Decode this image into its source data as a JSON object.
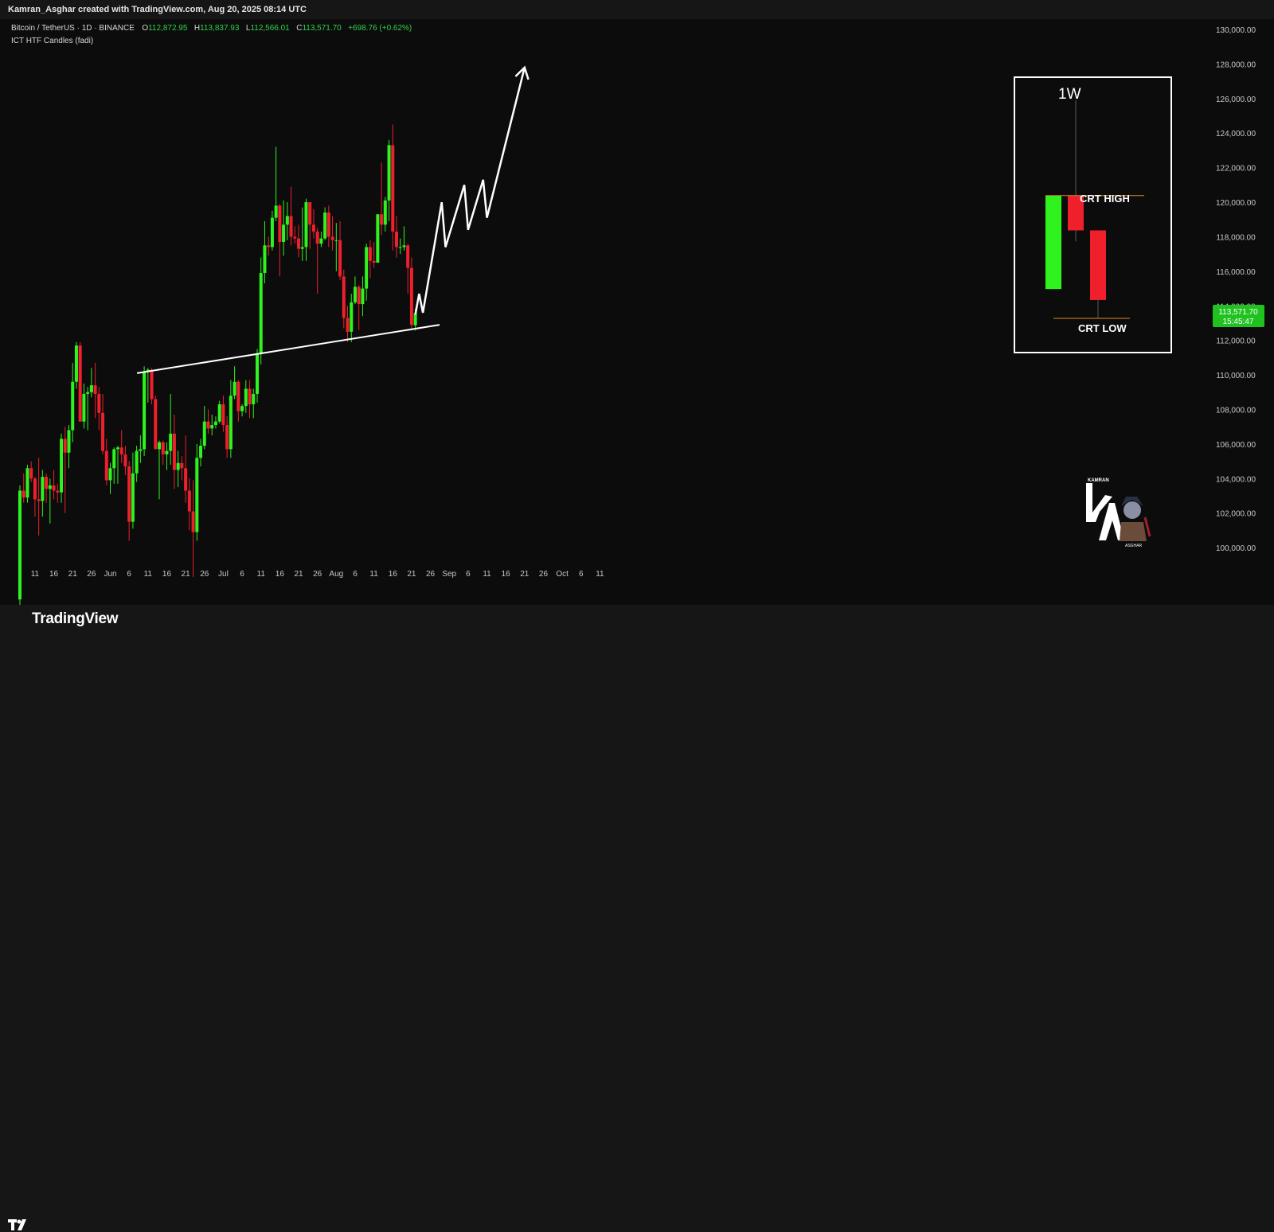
{
  "header": {
    "credit": "Kamran_Asghar created with TradingView.com, Aug 20, 2025 08:14 UTC"
  },
  "legend": {
    "symbol": "Bitcoin / TetherUS · 1D · BINANCE",
    "o_label": "O",
    "open": "112,872.95",
    "h_label": "H",
    "high": "113,837.93",
    "l_label": "L",
    "low": "112,566.01",
    "c_label": "C",
    "close": "113,571.70",
    "change": "+698.76 (+0.62%)",
    "indicator": "ICT HTF Candles (fadi)"
  },
  "price_tag": {
    "price": "113,571.70",
    "countdown": "15:45:47"
  },
  "inset": {
    "timeframe": "1W",
    "crt_high": "CRT HIGH",
    "crt_low": "CRT LOW"
  },
  "watermark": {
    "top": "KAMRAN",
    "bottom": "ASGHAR"
  },
  "footer": {
    "brand": "TradingView",
    "brand_mark": "TV"
  },
  "colors": {
    "up": "#2ff31f",
    "down": "#ef1f2c",
    "background": "#0c0c0c",
    "line": "#ffffff",
    "tag": "#1fc21f"
  },
  "chart_data": {
    "type": "candlestick",
    "symbol": "BTCUSDT",
    "interval": "1D",
    "x_axis_labels": [
      "11",
      "16",
      "21",
      "26",
      "Jun",
      "6",
      "11",
      "16",
      "21",
      "26",
      "Jul",
      "6",
      "11",
      "16",
      "21",
      "26",
      "Aug",
      "6",
      "11",
      "16",
      "21",
      "26",
      "Sep",
      "6",
      "11",
      "16",
      "21",
      "26",
      "Oct",
      "6",
      "11"
    ],
    "y_axis_labels": [
      "100,000.00",
      "102,000.00",
      "104,000.00",
      "106,000.00",
      "108,000.00",
      "110,000.00",
      "112,000.00",
      "114,000.00",
      "116,000.00",
      "118,000.00",
      "120,000.00",
      "122,000.00",
      "124,000.00",
      "126,000.00",
      "128,000.00",
      "130,000.00"
    ],
    "ylim": [
      98300,
      130600
    ],
    "candles": [
      {
        "date": "2025-05-07",
        "o": 97000,
        "h": 103600,
        "l": 96500,
        "c": 103300
      },
      {
        "date": "2025-05-08",
        "o": 103300,
        "h": 104300,
        "l": 102600,
        "c": 102900
      },
      {
        "date": "2025-05-09",
        "o": 102900,
        "h": 104800,
        "l": 102600,
        "c": 104600
      },
      {
        "date": "2025-05-10",
        "o": 104600,
        "h": 105000,
        "l": 103800,
        "c": 104000
      },
      {
        "date": "2025-05-11",
        "o": 104000,
        "h": 104100,
        "l": 101800,
        "c": 102800
      },
      {
        "date": "2025-05-12",
        "o": 102800,
        "h": 105200,
        "l": 100700,
        "c": 102700
      },
      {
        "date": "2025-05-13",
        "o": 102700,
        "h": 104500,
        "l": 101800,
        "c": 104100
      },
      {
        "date": "2025-05-14",
        "o": 104100,
        "h": 104300,
        "l": 102600,
        "c": 103400
      },
      {
        "date": "2025-05-15",
        "o": 103400,
        "h": 104000,
        "l": 101400,
        "c": 103600
      },
      {
        "date": "2025-05-16",
        "o": 103600,
        "h": 104500,
        "l": 102800,
        "c": 103300
      },
      {
        "date": "2025-05-17",
        "o": 103300,
        "h": 103700,
        "l": 102600,
        "c": 103200
      },
      {
        "date": "2025-05-18",
        "o": 103200,
        "h": 106600,
        "l": 102600,
        "c": 106300
      },
      {
        "date": "2025-05-19",
        "o": 106300,
        "h": 107000,
        "l": 102000,
        "c": 105500
      },
      {
        "date": "2025-05-20",
        "o": 105500,
        "h": 107100,
        "l": 104600,
        "c": 106800
      },
      {
        "date": "2025-05-21",
        "o": 106800,
        "h": 110700,
        "l": 106100,
        "c": 109600
      },
      {
        "date": "2025-05-22",
        "o": 109600,
        "h": 111900,
        "l": 109200,
        "c": 111700
      },
      {
        "date": "2025-05-23",
        "o": 111700,
        "h": 111900,
        "l": 107300,
        "c": 107300
      },
      {
        "date": "2025-05-24",
        "o": 107300,
        "h": 109500,
        "l": 106900,
        "c": 108900
      },
      {
        "date": "2025-05-25",
        "o": 108900,
        "h": 109300,
        "l": 106800,
        "c": 109000
      },
      {
        "date": "2025-05-26",
        "o": 109000,
        "h": 110400,
        "l": 108700,
        "c": 109400
      },
      {
        "date": "2025-05-27",
        "o": 109400,
        "h": 110700,
        "l": 107500,
        "c": 108900
      },
      {
        "date": "2025-05-28",
        "o": 108900,
        "h": 109300,
        "l": 106800,
        "c": 107800
      },
      {
        "date": "2025-05-29",
        "o": 107800,
        "h": 108900,
        "l": 105400,
        "c": 105600
      },
      {
        "date": "2025-05-30",
        "o": 105600,
        "h": 106300,
        "l": 103600,
        "c": 103900
      },
      {
        "date": "2025-05-31",
        "o": 103900,
        "h": 104900,
        "l": 103100,
        "c": 104600
      },
      {
        "date": "2025-06-01",
        "o": 104600,
        "h": 105800,
        "l": 103700,
        "c": 105700
      },
      {
        "date": "2025-06-02",
        "o": 105700,
        "h": 105900,
        "l": 103700,
        "c": 105800
      },
      {
        "date": "2025-06-03",
        "o": 105800,
        "h": 106800,
        "l": 104900,
        "c": 105400
      },
      {
        "date": "2025-06-04",
        "o": 105400,
        "h": 105900,
        "l": 104200,
        "c": 104700
      },
      {
        "date": "2025-06-05",
        "o": 104700,
        "h": 105000,
        "l": 100400,
        "c": 101500
      },
      {
        "date": "2025-06-06",
        "o": 101500,
        "h": 105500,
        "l": 101100,
        "c": 104300
      },
      {
        "date": "2025-06-07",
        "o": 104300,
        "h": 105900,
        "l": 103800,
        "c": 105600
      },
      {
        "date": "2025-06-08",
        "o": 105600,
        "h": 106500,
        "l": 104900,
        "c": 105700
      },
      {
        "date": "2025-06-09",
        "o": 105700,
        "h": 110500,
        "l": 105300,
        "c": 110200
      },
      {
        "date": "2025-06-10",
        "o": 110200,
        "h": 110400,
        "l": 108400,
        "c": 110300
      },
      {
        "date": "2025-06-11",
        "o": 110300,
        "h": 110400,
        "l": 108300,
        "c": 108600
      },
      {
        "date": "2025-06-12",
        "o": 108600,
        "h": 108800,
        "l": 105700,
        "c": 105700
      },
      {
        "date": "2025-06-13",
        "o": 105700,
        "h": 106200,
        "l": 102800,
        "c": 106100
      },
      {
        "date": "2025-06-14",
        "o": 106100,
        "h": 106200,
        "l": 104800,
        "c": 105400
      },
      {
        "date": "2025-06-15",
        "o": 105400,
        "h": 106100,
        "l": 104500,
        "c": 105600
      },
      {
        "date": "2025-06-16",
        "o": 105600,
        "h": 108900,
        "l": 104800,
        "c": 106600
      },
      {
        "date": "2025-06-17",
        "o": 106600,
        "h": 107700,
        "l": 103400,
        "c": 104500
      },
      {
        "date": "2025-06-18",
        "o": 104500,
        "h": 105600,
        "l": 103500,
        "c": 104900
      },
      {
        "date": "2025-06-19",
        "o": 104900,
        "h": 105300,
        "l": 103900,
        "c": 104600
      },
      {
        "date": "2025-06-20",
        "o": 104600,
        "h": 106500,
        "l": 102600,
        "c": 103300
      },
      {
        "date": "2025-06-21",
        "o": 103300,
        "h": 104000,
        "l": 101000,
        "c": 102100
      },
      {
        "date": "2025-06-22",
        "o": 102100,
        "h": 103900,
        "l": 98300,
        "c": 100900
      },
      {
        "date": "2025-06-23",
        "o": 100900,
        "h": 106000,
        "l": 100400,
        "c": 105200
      },
      {
        "date": "2025-06-24",
        "o": 105200,
        "h": 106300,
        "l": 104700,
        "c": 105900
      },
      {
        "date": "2025-06-25",
        "o": 105900,
        "h": 108200,
        "l": 105700,
        "c": 107300
      },
      {
        "date": "2025-06-26",
        "o": 107300,
        "h": 108000,
        "l": 106600,
        "c": 106900
      },
      {
        "date": "2025-06-27",
        "o": 106900,
        "h": 107700,
        "l": 106500,
        "c": 107100
      },
      {
        "date": "2025-06-28",
        "o": 107100,
        "h": 107600,
        "l": 106900,
        "c": 107300
      },
      {
        "date": "2025-06-29",
        "o": 107300,
        "h": 108500,
        "l": 107200,
        "c": 108300
      },
      {
        "date": "2025-06-30",
        "o": 108300,
        "h": 108800,
        "l": 106700,
        "c": 107100
      },
      {
        "date": "2025-07-01",
        "o": 107100,
        "h": 107600,
        "l": 105200,
        "c": 105700
      },
      {
        "date": "2025-07-02",
        "o": 105700,
        "h": 109700,
        "l": 105200,
        "c": 108800
      },
      {
        "date": "2025-07-03",
        "o": 108800,
        "h": 110500,
        "l": 108600,
        "c": 109600
      },
      {
        "date": "2025-07-04",
        "o": 109600,
        "h": 109700,
        "l": 107300,
        "c": 107900
      },
      {
        "date": "2025-07-05",
        "o": 107900,
        "h": 108300,
        "l": 107600,
        "c": 108200
      },
      {
        "date": "2025-07-06",
        "o": 108200,
        "h": 109700,
        "l": 107800,
        "c": 109200
      },
      {
        "date": "2025-07-07",
        "o": 109200,
        "h": 109700,
        "l": 107500,
        "c": 108300
      },
      {
        "date": "2025-07-08",
        "o": 108300,
        "h": 109200,
        "l": 107500,
        "c": 108900
      },
      {
        "date": "2025-07-09",
        "o": 108900,
        "h": 111500,
        "l": 108400,
        "c": 111200
      },
      {
        "date": "2025-07-10",
        "o": 111200,
        "h": 116800,
        "l": 110600,
        "c": 115900
      },
      {
        "date": "2025-07-11",
        "o": 115900,
        "h": 118900,
        "l": 115300,
        "c": 117500
      },
      {
        "date": "2025-07-12",
        "o": 117500,
        "h": 118000,
        "l": 116900,
        "c": 117400
      },
      {
        "date": "2025-07-13",
        "o": 117400,
        "h": 119500,
        "l": 117200,
        "c": 119100
      },
      {
        "date": "2025-07-14",
        "o": 119100,
        "h": 123200,
        "l": 118900,
        "c": 119800
      },
      {
        "date": "2025-07-15",
        "o": 119800,
        "h": 119900,
        "l": 115700,
        "c": 117700
      },
      {
        "date": "2025-07-16",
        "o": 117700,
        "h": 120100,
        "l": 116900,
        "c": 118700
      },
      {
        "date": "2025-07-17",
        "o": 118700,
        "h": 120000,
        "l": 117800,
        "c": 119200
      },
      {
        "date": "2025-07-18",
        "o": 119200,
        "h": 120900,
        "l": 117500,
        "c": 118000
      },
      {
        "date": "2025-07-19",
        "o": 118000,
        "h": 118600,
        "l": 117600,
        "c": 117900
      },
      {
        "date": "2025-07-20",
        "o": 117900,
        "h": 118700,
        "l": 116800,
        "c": 117300
      },
      {
        "date": "2025-07-21",
        "o": 117300,
        "h": 119700,
        "l": 116600,
        "c": 117400
      },
      {
        "date": "2025-07-22",
        "o": 117400,
        "h": 120200,
        "l": 116600,
        "c": 120000
      },
      {
        "date": "2025-07-23",
        "o": 120000,
        "h": 120000,
        "l": 117300,
        "c": 118700
      },
      {
        "date": "2025-07-24",
        "o": 118700,
        "h": 119600,
        "l": 117900,
        "c": 118300
      },
      {
        "date": "2025-07-25",
        "o": 118300,
        "h": 118500,
        "l": 114700,
        "c": 117600
      },
      {
        "date": "2025-07-26",
        "o": 117600,
        "h": 118300,
        "l": 117400,
        "c": 117900
      },
      {
        "date": "2025-07-27",
        "o": 117900,
        "h": 119700,
        "l": 117800,
        "c": 119400
      },
      {
        "date": "2025-07-28",
        "o": 119400,
        "h": 119800,
        "l": 117400,
        "c": 118000
      },
      {
        "date": "2025-07-29",
        "o": 118000,
        "h": 119200,
        "l": 117200,
        "c": 117800
      },
      {
        "date": "2025-07-30",
        "o": 117800,
        "h": 118800,
        "l": 116000,
        "c": 117800
      },
      {
        "date": "2025-07-31",
        "o": 117800,
        "h": 118900,
        "l": 115500,
        "c": 115700
      },
      {
        "date": "2025-08-01",
        "o": 115700,
        "h": 116100,
        "l": 112700,
        "c": 113300
      },
      {
        "date": "2025-08-02",
        "o": 113300,
        "h": 114000,
        "l": 111900,
        "c": 112500
      },
      {
        "date": "2025-08-03",
        "o": 112500,
        "h": 114700,
        "l": 111900,
        "c": 114200
      },
      {
        "date": "2025-08-04",
        "o": 114200,
        "h": 115700,
        "l": 114100,
        "c": 115100
      },
      {
        "date": "2025-08-05",
        "o": 115100,
        "h": 115200,
        "l": 112600,
        "c": 114100
      },
      {
        "date": "2025-08-06",
        "o": 114100,
        "h": 115700,
        "l": 113400,
        "c": 115000
      },
      {
        "date": "2025-08-07",
        "o": 115000,
        "h": 117600,
        "l": 114300,
        "c": 117400
      },
      {
        "date": "2025-08-08",
        "o": 117400,
        "h": 117800,
        "l": 115600,
        "c": 116600
      },
      {
        "date": "2025-08-09",
        "o": 116600,
        "h": 117700,
        "l": 116200,
        "c": 116500
      },
      {
        "date": "2025-08-10",
        "o": 116500,
        "h": 119300,
        "l": 116500,
        "c": 119300
      },
      {
        "date": "2025-08-11",
        "o": 119300,
        "h": 122300,
        "l": 118100,
        "c": 118700
      },
      {
        "date": "2025-08-12",
        "o": 118700,
        "h": 120300,
        "l": 118300,
        "c": 120100
      },
      {
        "date": "2025-08-13",
        "o": 120100,
        "h": 123600,
        "l": 118900,
        "c": 123300
      },
      {
        "date": "2025-08-14",
        "o": 123300,
        "h": 124500,
        "l": 117200,
        "c": 118300
      },
      {
        "date": "2025-08-15",
        "o": 118300,
        "h": 119200,
        "l": 116800,
        "c": 117400
      },
      {
        "date": "2025-08-16",
        "o": 117400,
        "h": 117900,
        "l": 117000,
        "c": 117400
      },
      {
        "date": "2025-08-17",
        "o": 117400,
        "h": 118600,
        "l": 117200,
        "c": 117500
      },
      {
        "date": "2025-08-18",
        "o": 117500,
        "h": 117600,
        "l": 114700,
        "c": 116200
      },
      {
        "date": "2025-08-19",
        "o": 116200,
        "h": 116800,
        "l": 112700,
        "c": 112900
      },
      {
        "date": "2025-08-20",
        "o": 112873,
        "h": 113838,
        "l": 112566,
        "c": 113572
      }
    ],
    "trendline": {
      "from": {
        "date": "2025-06-09",
        "price": 110100
      },
      "to": {
        "date": "2025-08-26",
        "price": 112900
      }
    },
    "projection_path": [
      {
        "date": "2025-08-20",
        "price": 113500
      },
      {
        "date": "2025-08-21",
        "price": 114700
      },
      {
        "date": "2025-08-22",
        "price": 113600
      },
      {
        "date": "2025-08-27",
        "price": 120000
      },
      {
        "date": "2025-08-28",
        "price": 117400
      },
      {
        "date": "2025-09-02",
        "price": 121000
      },
      {
        "date": "2025-09-03",
        "price": 118400
      },
      {
        "date": "2025-09-07",
        "price": 121300
      },
      {
        "date": "2025-09-08",
        "price": 119100
      },
      {
        "date": "2025-09-18",
        "price": 127800
      }
    ],
    "inset_weekly_candles": [
      {
        "o": 114200,
        "h": 119300,
        "l": 114200,
        "c": 119300
      },
      {
        "o": 119300,
        "h": 124500,
        "l": 116800,
        "c": 117400
      },
      {
        "o": 117400,
        "h": 117400,
        "l": 112600,
        "c": 113600
      }
    ],
    "inset_levels": {
      "crt_high": 119300,
      "crt_low": 112600
    }
  }
}
